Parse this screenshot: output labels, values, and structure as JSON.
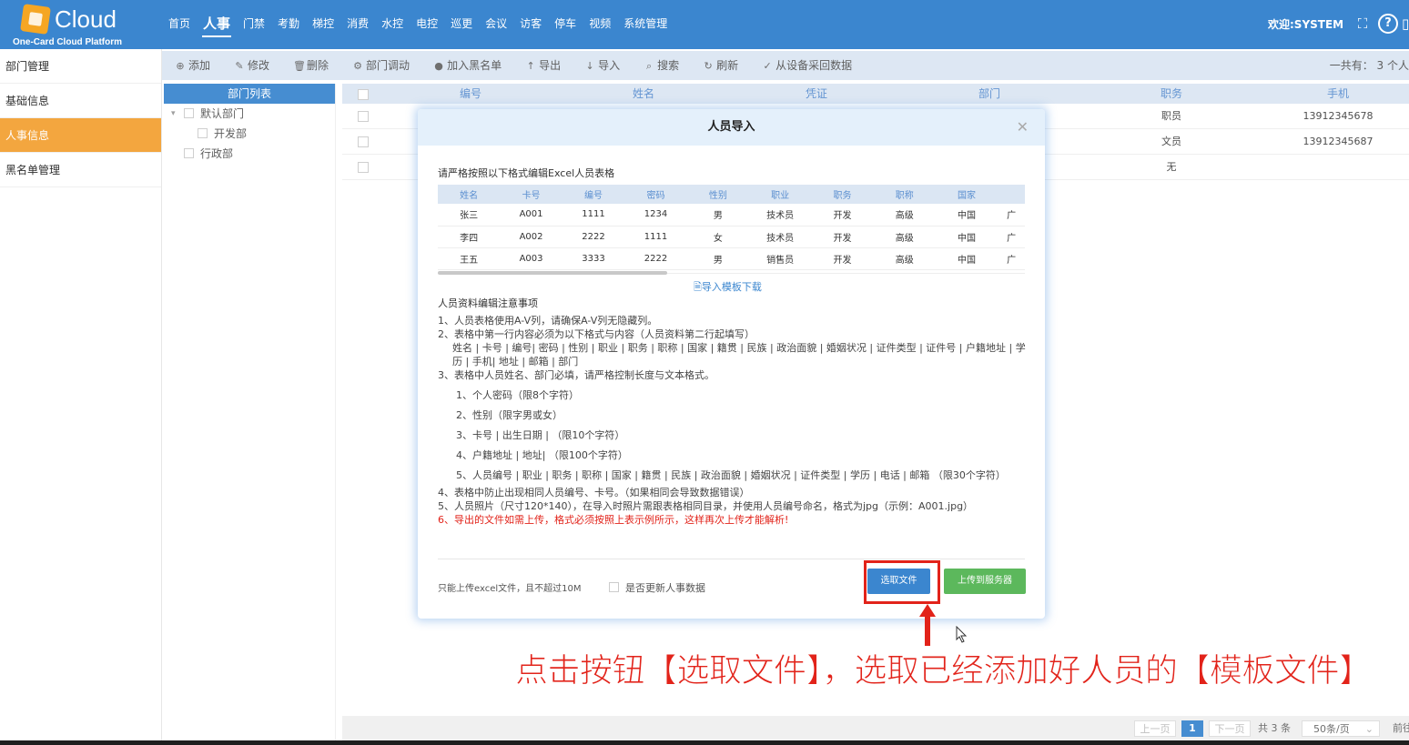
{
  "brand": {
    "name": "Cloud",
    "subtitle": "One-Card Cloud Platform"
  },
  "nav": [
    "首页",
    "人事",
    "门禁",
    "考勤",
    "梯控",
    "消费",
    "水控",
    "电控",
    "巡更",
    "会议",
    "访客",
    "停车",
    "视频",
    "系统管理"
  ],
  "nav_active": "人事",
  "welcome": "欢迎:SYSTEM",
  "sidebar": [
    {
      "label": "部门管理",
      "active": false
    },
    {
      "label": "基础信息",
      "active": false
    },
    {
      "label": "人事信息",
      "active": true
    },
    {
      "label": "黑名单管理",
      "active": false
    }
  ],
  "toolbar": [
    {
      "icon": "add-icon",
      "label": "添加"
    },
    {
      "icon": "edit-icon",
      "label": "修改"
    },
    {
      "icon": "delete-icon",
      "label": "删除"
    },
    {
      "icon": "gear-icon",
      "label": "部门调动"
    },
    {
      "icon": "block-icon",
      "label": "加入黑名单"
    },
    {
      "icon": "export-icon",
      "label": "导出"
    },
    {
      "icon": "import-icon",
      "label": "导入"
    },
    {
      "icon": "search-icon",
      "label": "搜索"
    },
    {
      "icon": "refresh-icon",
      "label": "刷新"
    },
    {
      "icon": "check-icon",
      "label": "从设备采回数据"
    }
  ],
  "total_text": "一共有： 3 个人",
  "dept_tree": {
    "header": "部门列表",
    "nodes": [
      {
        "label": "默认部门",
        "level": 0
      },
      {
        "label": "开发部",
        "level": 1
      },
      {
        "label": "行政部",
        "level": 0
      }
    ]
  },
  "grid": {
    "columns": [
      "编号",
      "姓名",
      "凭证",
      "部门",
      "职务",
      "手机"
    ],
    "rows": [
      {
        "zhiwu": "职员",
        "phone": "13912345678"
      },
      {
        "zhiwu": "文员",
        "phone": "13912345687"
      },
      {
        "zhiwu": "无",
        "phone": ""
      }
    ]
  },
  "pager": {
    "prev": "上一页",
    "current": "1",
    "next": "下一页",
    "total": "共 3 条",
    "size": "50条/页",
    "goto": "前往"
  },
  "modal": {
    "title": "人员导入",
    "intro": "请严格按照以下格式编辑Excel人员表格",
    "example_headers": [
      "姓名",
      "卡号",
      "编号",
      "密码",
      "性别",
      "职业",
      "职务",
      "职称",
      "国家",
      ""
    ],
    "example_rows": [
      [
        "张三",
        "A001",
        "1111",
        "1234",
        "男",
        "技术员",
        "开发",
        "高级",
        "中国",
        "广"
      ],
      [
        "李四",
        "A002",
        "2222",
        "1111",
        "女",
        "技术员",
        "开发",
        "高级",
        "中国",
        "广"
      ],
      [
        "王五",
        "A003",
        "3333",
        "2222",
        "男",
        "销售员",
        "开发",
        "高级",
        "中国",
        "广"
      ]
    ],
    "template_link": "导入模板下载",
    "notes_title": "人员资料编辑注意事项",
    "note1": "1、人员表格使用A-V列，请确保A-V列无隐藏列。",
    "note2": "2、表格中第一行内容必须为以下格式与内容（人员资料第二行起填写）",
    "note2_fields": "姓名 | 卡号 | 编号| 密码 | 性别 | 职业 | 职务 | 职称 | 国家 | 籍贯 | 民族 | 政治面貌 | 婚姻状况 | 证件类型 | 证件号 | 户籍地址 | 学历 | 手机| 地址 | 邮箱 | 部门",
    "note3": "3、表格中人员姓名、部门必填，请严格控制长度与文本格式。",
    "note3_sub": [
      "1、个人密码（限8个字符）",
      "2、性别（限字男或女）",
      "3、卡号 | 出生日期 | （限10个字符）",
      "4、户籍地址 | 地址| （限100个字符）",
      "5、人员编号 | 职业 | 职务 | 职称 | 国家 | 籍贯 | 民族 | 政治面貌 | 婚姻状况 | 证件类型 | 学历 | 电话 | 邮箱 （限30个字符）"
    ],
    "note4": "4、表格中防止出现相同人员编号、卡号。（如果相同会导致数据错误）",
    "note5": "5、人员照片（尺寸120*140），在导入时照片需跟表格相同目录，并使用人员编号命名，格式为jpg（示例：A001.jpg）",
    "note6": "6、导出的文件如需上传，格式必须按照上表示例所示，这样再次上传才能解析!",
    "hint": "只能上传excel文件，且不超过10M",
    "update_label": "是否更新人事数据",
    "select_button": "选取文件",
    "upload_button": "上传到服务器"
  },
  "caption": "点击按钮【选取文件】，选取已经添加好人员的【模板文件】",
  "colors": {
    "primary": "#3b86cf",
    "accent": "#f3a134",
    "success": "#5cb85c",
    "annotation": "#e2231a"
  }
}
